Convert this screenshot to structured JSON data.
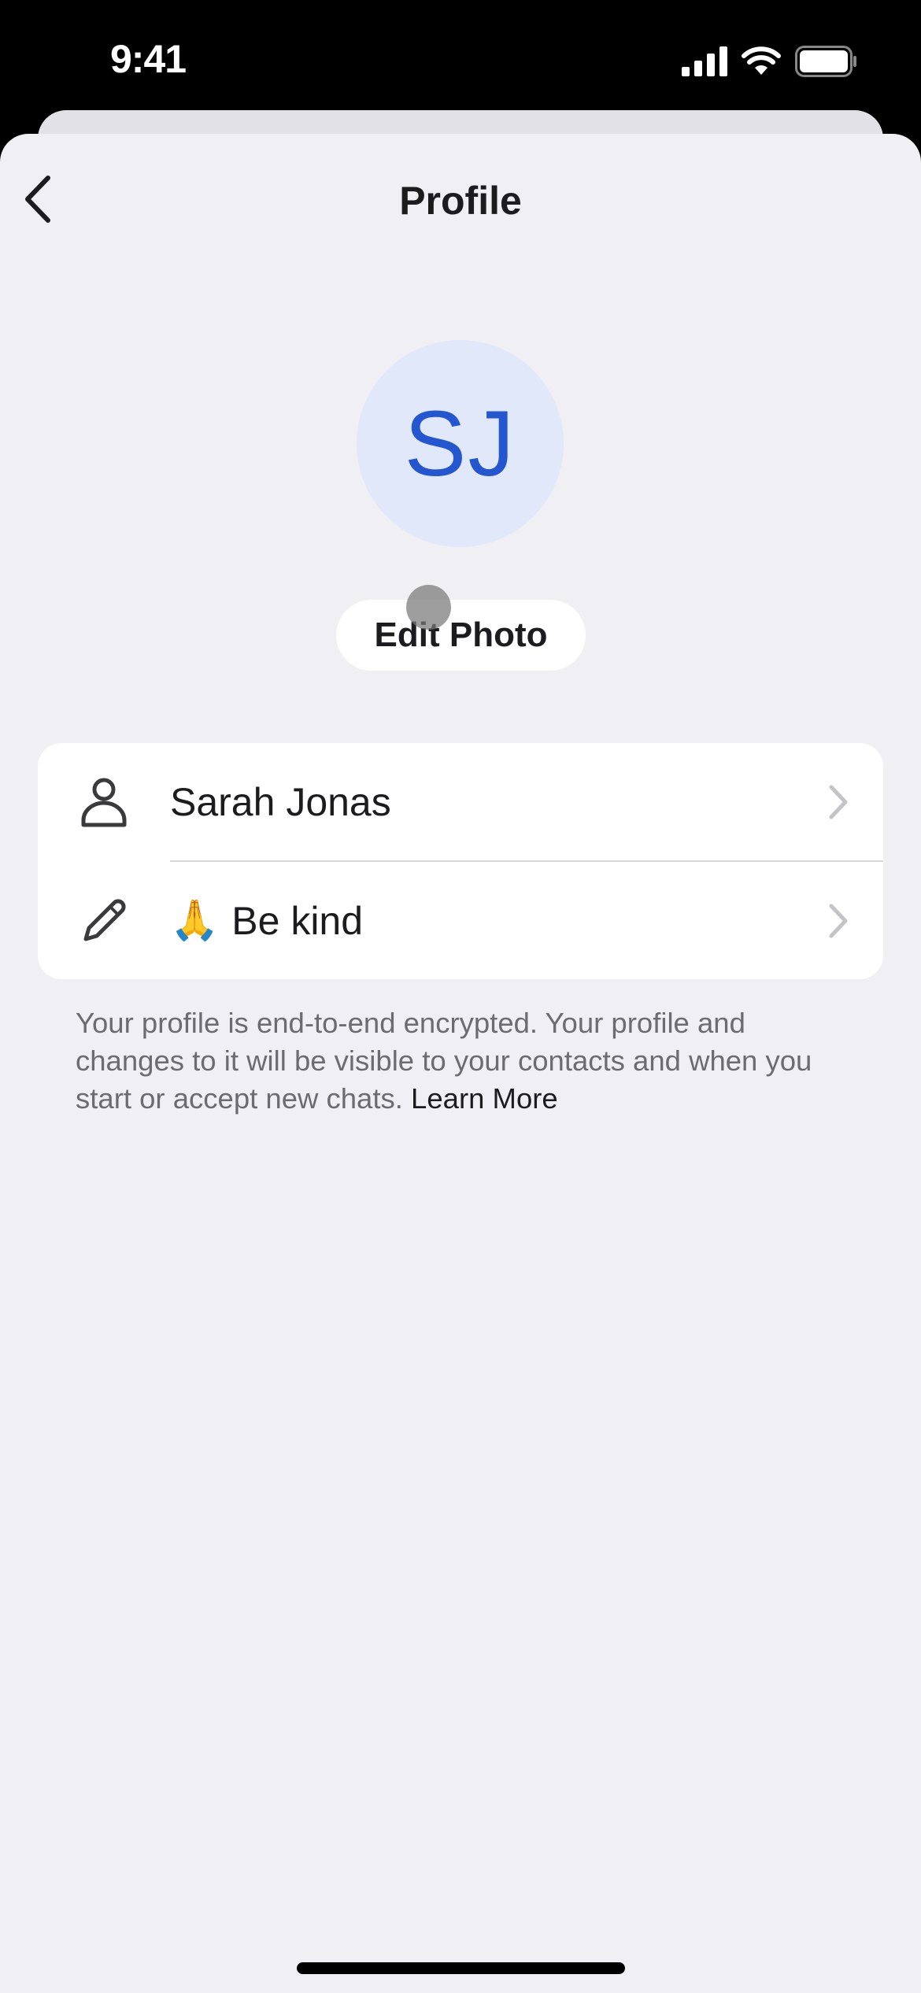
{
  "status_bar": {
    "time": "9:41",
    "icons": [
      "cellular-signal-icon",
      "wifi-icon",
      "battery-icon"
    ]
  },
  "nav": {
    "back_icon": "chevron-left-icon",
    "title": "Profile"
  },
  "avatar": {
    "initials": "SJ",
    "background_color": "#e1e8fa",
    "text_color": "#2356cf"
  },
  "edit_photo_label": "Edit Photo",
  "profile_rows": [
    {
      "icon": "person-icon",
      "emoji": "",
      "label": "Sarah Jonas",
      "trailing_icon": "chevron-right-icon"
    },
    {
      "icon": "pencil-icon",
      "emoji": "🙏",
      "label": "Be kind",
      "trailing_icon": "chevron-right-icon"
    }
  ],
  "footer": {
    "text": "Your profile is end-to-end encrypted. Your profile and changes to it will be visible to your contacts and when you start or accept new chats.",
    "link_label": "Learn More"
  }
}
